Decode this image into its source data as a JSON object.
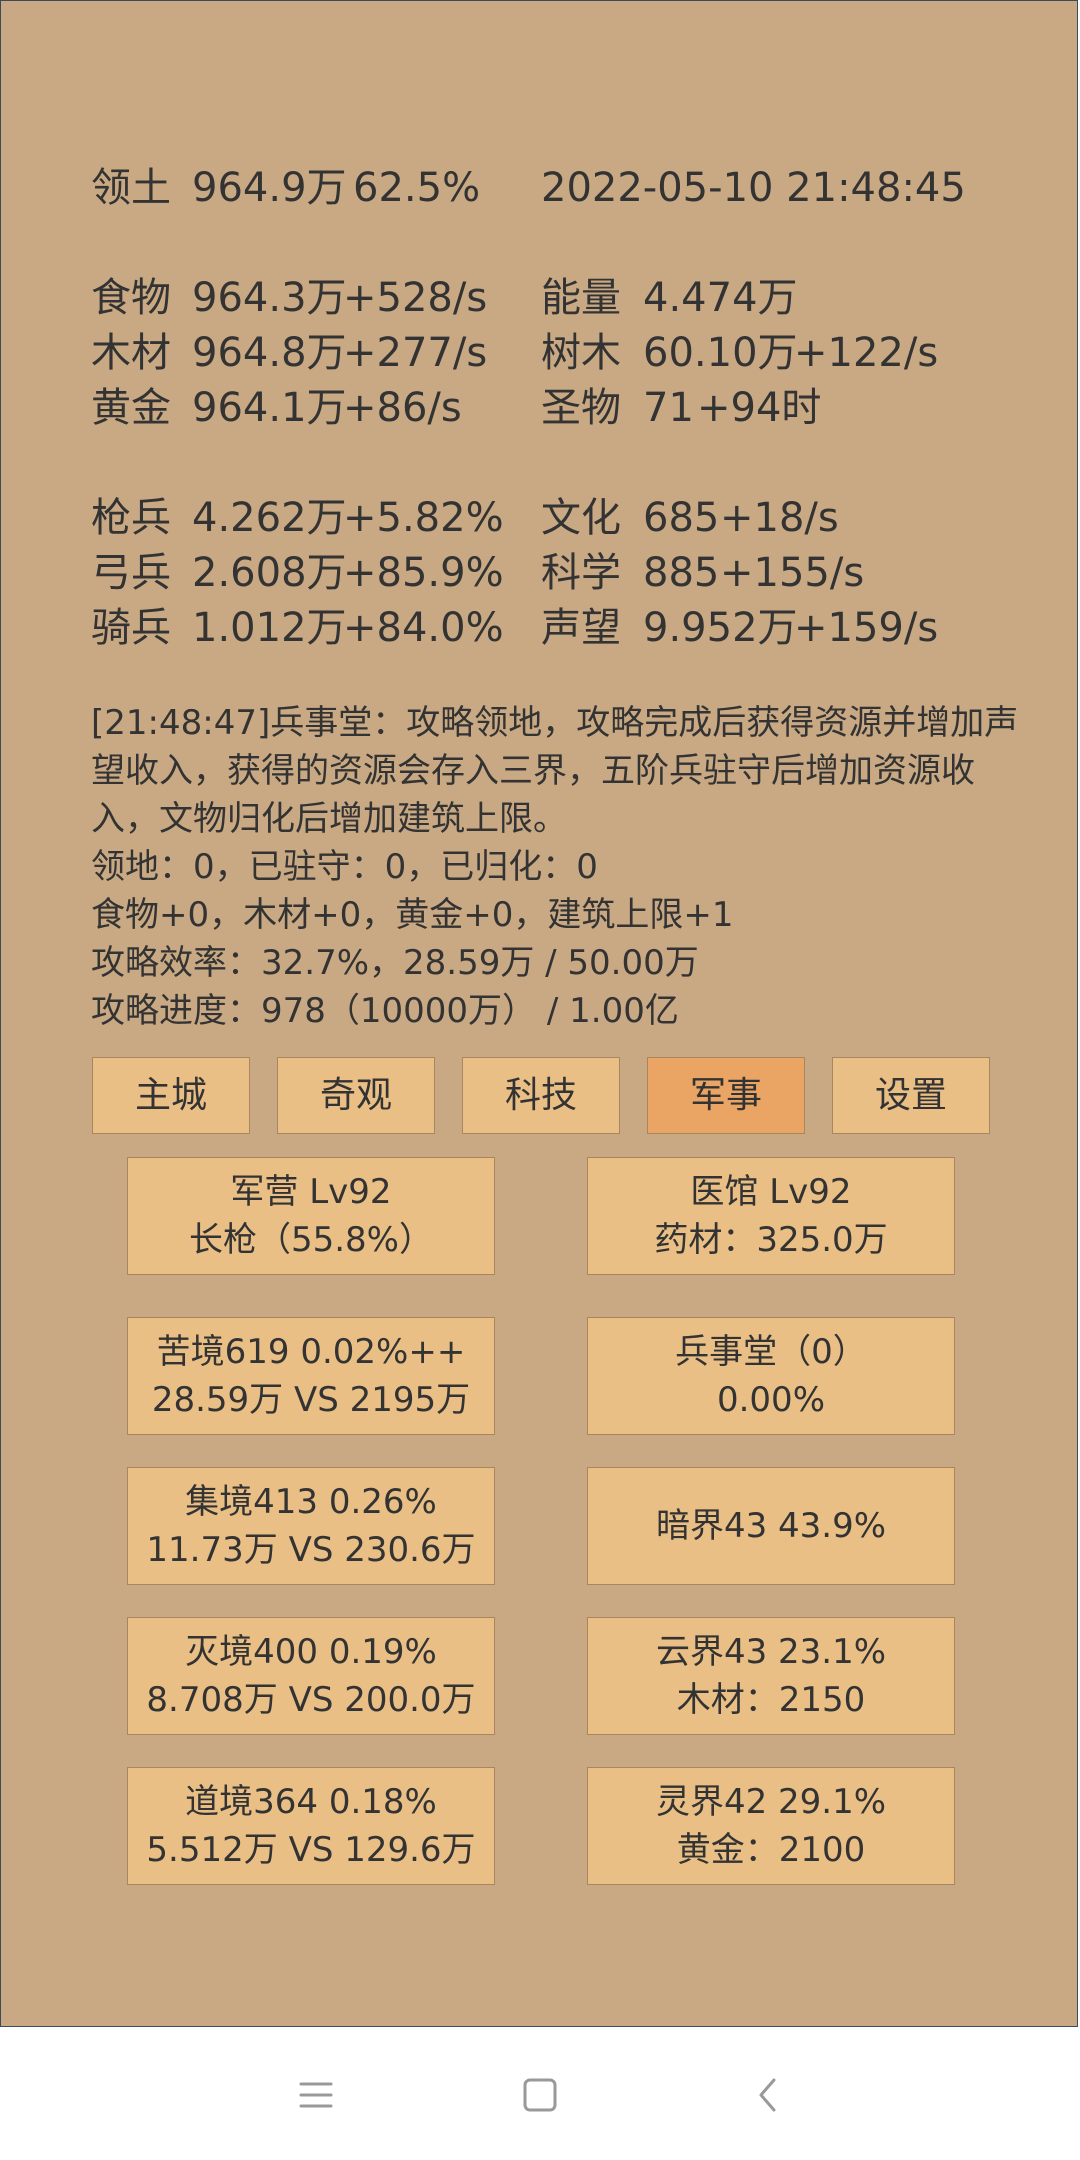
{
  "stats": {
    "territory": {
      "label": "领土",
      "value": "964.9万",
      "percent": "62.5%"
    },
    "datetime": "2022-05-10 21:48:45",
    "food": {
      "label": "食物",
      "value": "964.3万",
      "rate": "+528/s"
    },
    "wood": {
      "label": "木材",
      "value": "964.8万",
      "rate": "+277/s"
    },
    "gold": {
      "label": "黄金",
      "value": "964.1万",
      "rate": "+86/s"
    },
    "energy": {
      "label": "能量",
      "value": "4.474万"
    },
    "trees": {
      "label": "树木",
      "value": "60.10万",
      "rate": "+122/s"
    },
    "relic": {
      "label": "圣物",
      "value": "71",
      "rate": "+94时"
    },
    "spearman": {
      "label": "枪兵",
      "value": "4.262万",
      "rate": "+5.82%"
    },
    "archer": {
      "label": "弓兵",
      "value": "2.608万",
      "rate": "+85.9%"
    },
    "cavalry": {
      "label": "骑兵",
      "value": "1.012万",
      "rate": "+84.0%"
    },
    "culture": {
      "label": "文化",
      "value": "685",
      "rate": "+18/s"
    },
    "science": {
      "label": "科学",
      "value": "885",
      "rate": "+155/s"
    },
    "prestige": {
      "label": "声望",
      "value": "9.952万",
      "rate": "+159/s"
    }
  },
  "log": {
    "message": "[21:48:47]兵事堂：攻略领地，攻略完成后获得资源并增加声望收入，获得的资源会存入三界，五阶兵驻守后增加资源收入，文物归化后增加建筑上限。",
    "line2": "领地：0，已驻守：0，已归化：0",
    "line3": "食物+0，木材+0，黄金+0，建筑上限+1",
    "line4": "攻略效率：32.7%，28.59万 / 50.00万",
    "line5": "攻略进度：978（10000万） / 1.00亿"
  },
  "tabs": [
    {
      "label": "主城"
    },
    {
      "label": "奇观"
    },
    {
      "label": "科技"
    },
    {
      "label": "军事",
      "active": true
    },
    {
      "label": "设置"
    }
  ],
  "cards": {
    "barracks": {
      "line1": "军营 Lv92",
      "line2": "长枪（55.8%）"
    },
    "clinic": {
      "line1": "医馆 Lv92",
      "line2": "药材：325.0万"
    },
    "kujing": {
      "line1": "苦境619  0.02%++",
      "line2": "28.59万 VS 2195万"
    },
    "bingshitang": {
      "line1": "兵事堂（0）",
      "line2": "0.00%"
    },
    "jijing": {
      "line1": "集境413  0.26%",
      "line2": "11.73万 VS 230.6万"
    },
    "anjie": {
      "line1": "暗界43  43.9%"
    },
    "miejing": {
      "line1": "灭境400  0.19%",
      "line2": "8.708万 VS 200.0万"
    },
    "yunjie": {
      "line1": "云界43  23.1%",
      "line2": "木材：2150"
    },
    "daojing": {
      "line1": "道境364  0.18%",
      "line2": "5.512万 VS 129.6万"
    },
    "lingjie": {
      "line1": "灵界42  29.1%",
      "line2": "黄金：2100"
    }
  },
  "navbar": {
    "icons": [
      "menu-icon",
      "home-icon",
      "back-icon"
    ]
  }
}
